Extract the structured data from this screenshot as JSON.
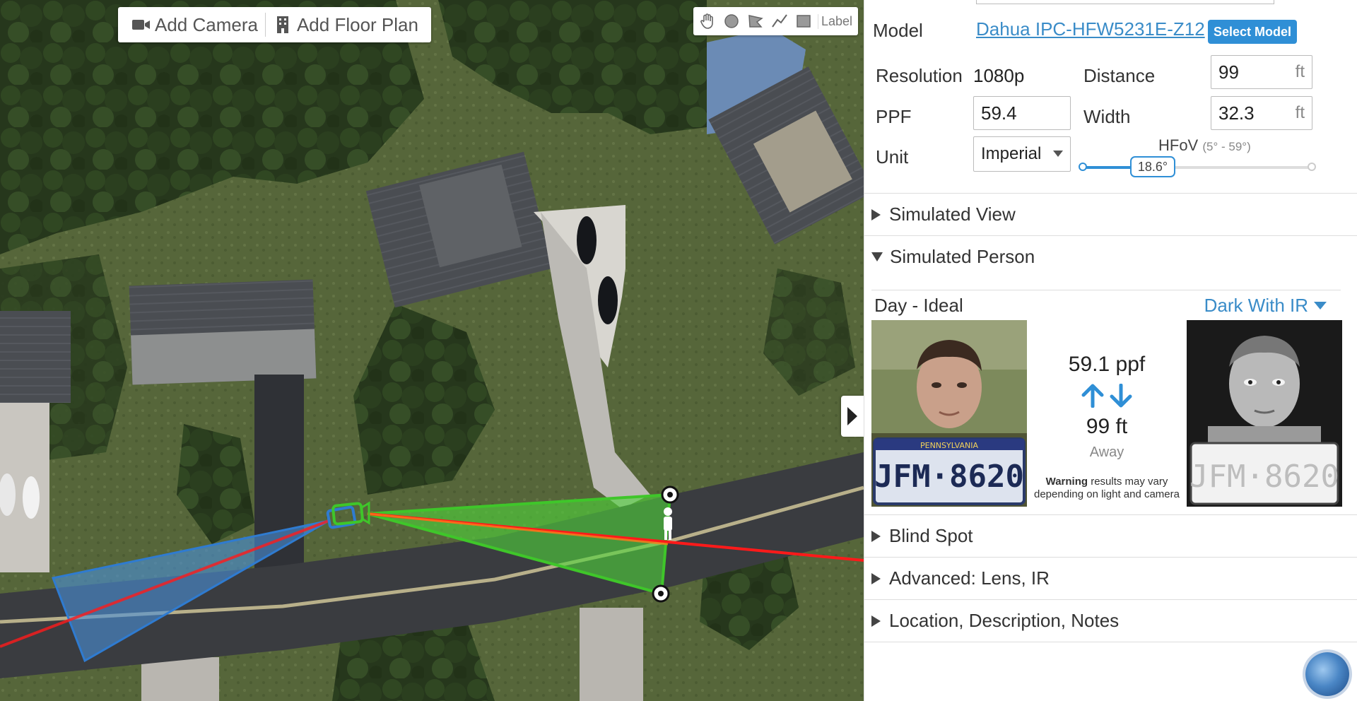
{
  "map": {
    "toolbar": {
      "add_camera": "Add Camera",
      "add_floor_plan": "Add Floor Plan"
    },
    "draw_tools": {
      "tools": [
        "hand-icon",
        "circle-icon",
        "flag-icon",
        "line-icon",
        "square-icon"
      ],
      "label": "Label"
    }
  },
  "panel": {
    "model_label": "Model",
    "model_name": "Dahua IPC-HFW5231E-Z12",
    "select_model": "Select Model",
    "resolution_label": "Resolution",
    "resolution_value": "1080p",
    "distance_label": "Distance",
    "distance_value": "99",
    "distance_unit": "ft",
    "ppf_label": "PPF",
    "ppf_value": "59.4",
    "width_label": "Width",
    "width_value": "32.3",
    "width_unit": "ft",
    "unit_label": "Unit",
    "unit_value": "Imperial",
    "hfov_label": "HFoV",
    "hfov_range": "(5° - 59°)",
    "hfov_value": "18.6°",
    "hfov_fraction": 0.307,
    "sections": {
      "simulated_view": "Simulated View",
      "simulated_person": "Simulated Person",
      "blind_spot": "Blind Spot",
      "advanced": "Advanced: Lens, IR",
      "location": "Location, Description, Notes"
    },
    "person": {
      "day_label": "Day - Ideal",
      "night_label": "Dark With IR",
      "ppf_readout": "59.1 ppf",
      "distance_readout": "99 ft",
      "away": "Away",
      "warning_bold": "Warning",
      "warning_text": " results may vary depending on light and camera",
      "plate_state": "PENNSYLVANIA",
      "plate_text": "JFM·8620"
    }
  },
  "colors": {
    "accent": "#2f8fd6",
    "link": "#3a8cc8",
    "fov_green": "#4fd43a",
    "fov_blue": "#4a90d9",
    "line_red": "#ff1a1a"
  }
}
